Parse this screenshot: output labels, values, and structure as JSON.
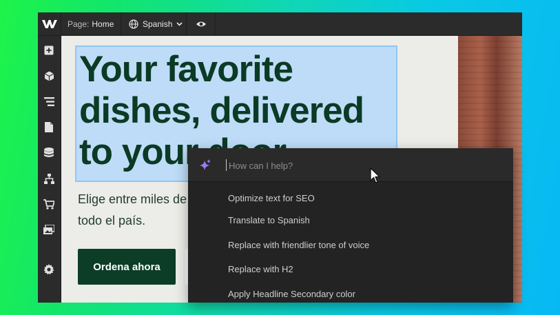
{
  "topbar": {
    "page_prefix": "Page:",
    "page_name": "Home",
    "language": "Spanish"
  },
  "sidebar": {
    "items": [
      {
        "icon": "add-icon"
      },
      {
        "icon": "components-cube-icon"
      },
      {
        "icon": "navigator-icon"
      },
      {
        "icon": "pages-icon"
      },
      {
        "icon": "cms-database-icon"
      },
      {
        "icon": "logic-flow-icon"
      },
      {
        "icon": "ecommerce-cart-icon"
      },
      {
        "icon": "assets-images-icon"
      },
      {
        "icon": "settings-gear-icon"
      }
    ]
  },
  "canvas": {
    "heading_lines": [
      "Your favorite",
      "dishes, delivered",
      "to your door"
    ],
    "paragraph_lines": [
      "Elige entre miles de",
      "todo el país."
    ],
    "cta_label": "Ordena ahora"
  },
  "assistant": {
    "placeholder": "How can I help?",
    "suggestions": [
      "Optimize text for SEO",
      "Translate to Spanish",
      "Replace with friendlier tone of voice",
      "Replace with H2",
      "Apply Headline Secondary color"
    ]
  },
  "colors": {
    "heading": "#0b3a25",
    "selection": "#bedcf7",
    "cta_bg": "#0c3d27",
    "panel_bg": "#232323",
    "sparkle": "#9b7cf5"
  }
}
